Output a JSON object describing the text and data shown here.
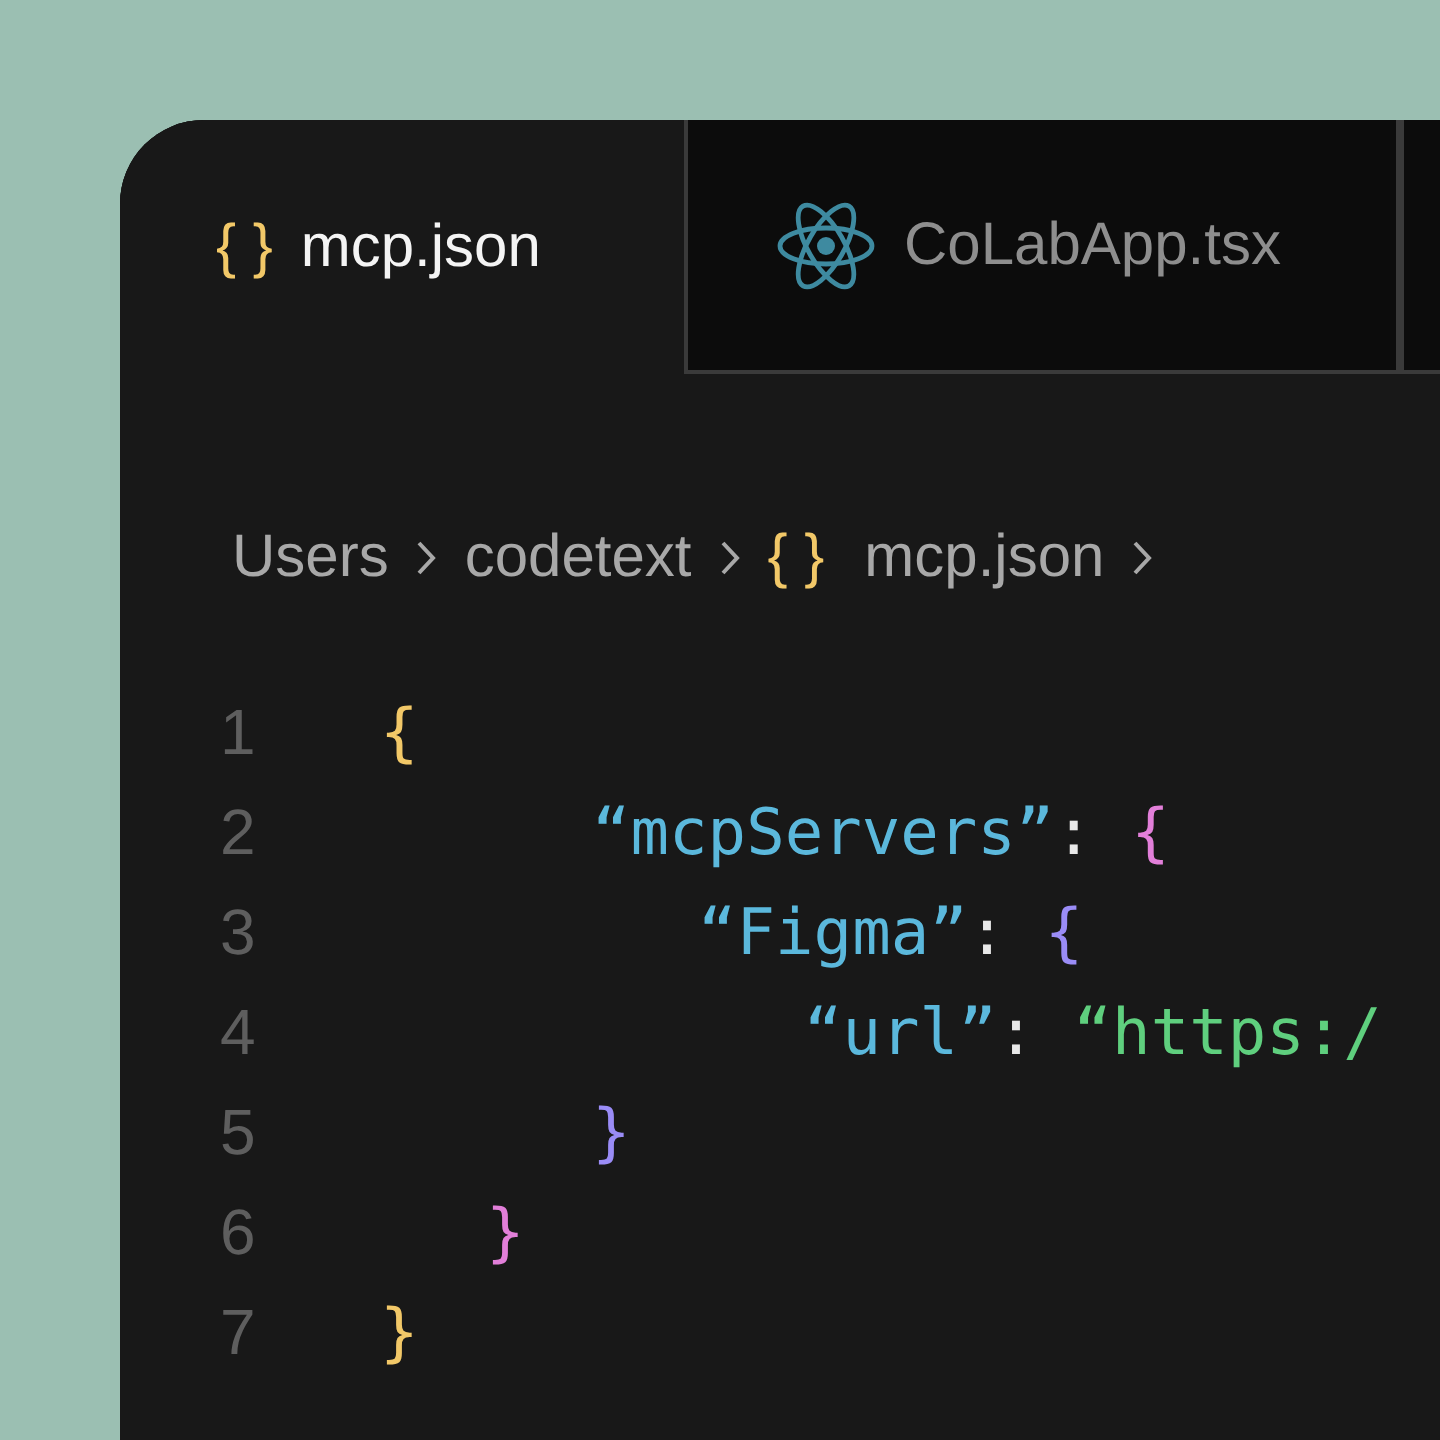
{
  "tabs": [
    {
      "label": "mcp.json",
      "kind": "json",
      "icon_text": "{ }",
      "selected": true
    },
    {
      "label": "CoLabApp.tsx",
      "kind": "react",
      "selected": false
    },
    {
      "selected": false
    }
  ],
  "breadcrumb": [
    {
      "label": "Users"
    },
    {
      "label": "codetext"
    },
    {
      "label": "mcp.json",
      "icon_text": "{ }"
    }
  ],
  "code": {
    "lines": [
      {
        "number": "1",
        "tokens": [
          {
            "kind": "brace",
            "text": "{",
            "color": "#f2c868"
          }
        ],
        "children": [
          {
            "number": "2",
            "tokens": [
              {
                "kind": "key",
                "text": "“mcpServers”"
              },
              {
                "kind": "colon",
                "text": ":"
              },
              {
                "kind": "brace",
                "text": "{",
                "color": "#e27fd9"
              }
            ],
            "children": [
              {
                "number": "3",
                "tokens": [
                  {
                    "kind": "key",
                    "text": "“Figma”"
                  },
                  {
                    "kind": "colon",
                    "text": ":"
                  },
                  {
                    "kind": "brace",
                    "text": "{",
                    "color": "#9a8cf6"
                  }
                ],
                "children": [
                  {
                    "number": "4",
                    "tokens": [
                      {
                        "kind": "key",
                        "text": "“url”"
                      },
                      {
                        "kind": "colon",
                        "text": ":"
                      },
                      {
                        "kind": "string",
                        "text": "“https:/"
                      }
                    ]
                  }
                ]
              },
              {
                "number": "5",
                "tokens": [
                  {
                    "kind": "brace",
                    "text": "}",
                    "color": "#9a8cf6"
                  }
                ]
              }
            ]
          },
          {
            "number": "6",
            "tokens": [
              {
                "kind": "brace",
                "text": "}",
                "color": "#e27fd9"
              }
            ]
          }
        ]
      },
      {
        "number": "7",
        "tokens": [
          {
            "kind": "brace",
            "text": "}",
            "color": "#f2c868"
          }
        ]
      }
    ]
  }
}
